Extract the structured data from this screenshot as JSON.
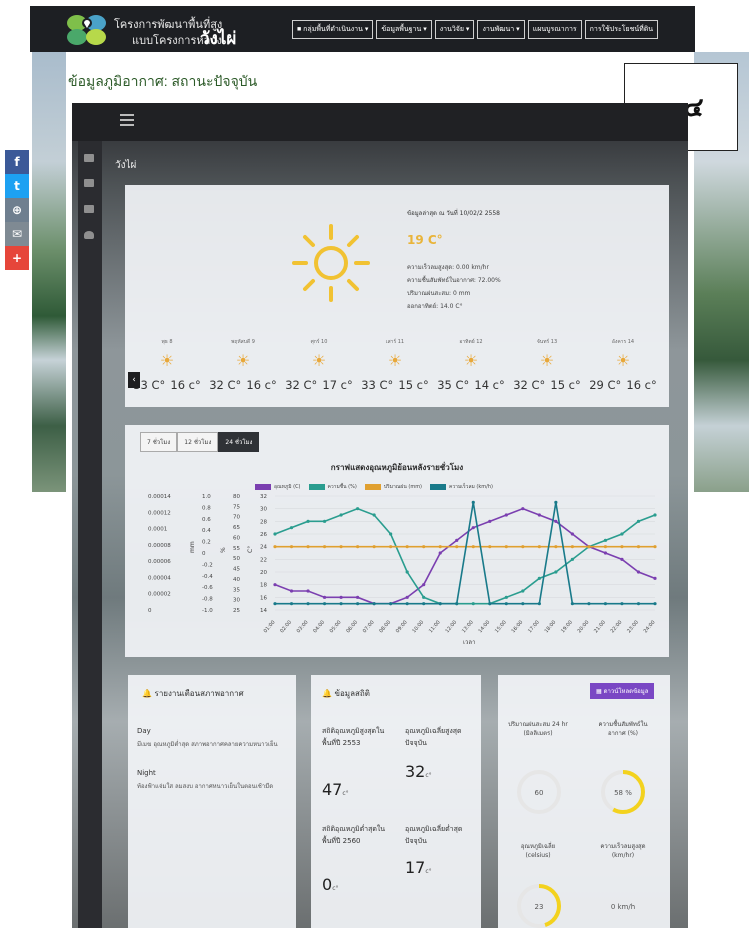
{
  "header": {
    "logo_line1": "โครงการพัฒนาพื้นที่สูง",
    "logo_line2": "แบบโครงการหลวง",
    "site_name": "วังไผ่",
    "nav": [
      {
        "label": "■ กลุ่มพื้นที่ดำเนินงาน ▾"
      },
      {
        "label": "ข้อมูลพื้นฐาน ▾"
      },
      {
        "label": "งานวิจัย ▾"
      },
      {
        "label": "งานพัฒนา ▾"
      },
      {
        "label": "แผนบูรณาการ"
      },
      {
        "label": "การใช้ประโยชน์ที่ดิน"
      }
    ]
  },
  "share": {
    "facebook": "f",
    "twitter": "t",
    "link": "⊕",
    "email": "✉",
    "more": "+"
  },
  "page_title": "ข้อมูลภูมิอากาศ: สถานะปัจจุบัน",
  "badge": "๑.๔",
  "location": "วังไผ่",
  "current": {
    "updated": "ข้อมูลล่าสุด ณ วันที่ 10/02/2 2558",
    "temperature": "19 C°",
    "lines": [
      "ความเร็วลมสูงสุด: 0.00 km/hr",
      "ความชื้นสัมพัทธ์ในอากาศ: 72.00%",
      "ปริมาณฝนสะสม: 0 mm",
      "ออกอาทิตย์: 14.0 C°"
    ]
  },
  "forecast": [
    {
      "day": "พุธ 8",
      "high": "33 C°",
      "low": "16 c°"
    },
    {
      "day": "พฤหัสบดี 9",
      "high": "32 C°",
      "low": "16 c°"
    },
    {
      "day": "ศุกร์ 10",
      "high": "32 C°",
      "low": "17 c°"
    },
    {
      "day": "เสาร์ 11",
      "high": "33 C°",
      "low": "15 c°"
    },
    {
      "day": "อาทิตย์ 12",
      "high": "35 C°",
      "low": "14 c°"
    },
    {
      "day": "จันทร์ 13",
      "high": "32 C°",
      "low": "15 c°"
    },
    {
      "day": "อังคาร 14",
      "high": "29 C°",
      "low": "16 c°"
    }
  ],
  "chart_tabs": [
    "7 ชั่วโมง",
    "12 ชั่วโมง",
    "24 ชั่วโมง"
  ],
  "chart_data": {
    "type": "line",
    "title": "กราฟแสดงอุณหภูมิย้อนหลังรายชั่วโมง",
    "xlabel": "เวลา",
    "x": [
      "01:00",
      "02:00",
      "03:00",
      "04:00",
      "05:00",
      "06:00",
      "07:00",
      "08:00",
      "09:00",
      "10:00",
      "11:00",
      "12:00",
      "13:00",
      "14:00",
      "15:00",
      "16:00",
      "17:00",
      "18:00",
      "19:00",
      "20:00",
      "21:00",
      "22:00",
      "23:00",
      "24:00"
    ],
    "axes": [
      {
        "ticks": [
          "0.00014",
          "0.00012",
          "0.0001",
          "0.00008",
          "0.00006",
          "0.00004",
          "0.00002",
          "0"
        ]
      },
      {
        "label": "mm",
        "ticks": [
          "1.0",
          "0.8",
          "0.6",
          "0.4",
          "0.2",
          "0",
          "-0.2",
          "-0.4",
          "-0.6",
          "-0.8",
          "-1.0"
        ]
      },
      {
        "label": "%",
        "ticks": [
          "80",
          "75",
          "70",
          "65",
          "60",
          "55",
          "50",
          "45",
          "40",
          "35",
          "30",
          "25"
        ]
      },
      {
        "label": "C°",
        "ticks": [
          "32",
          "30",
          "28",
          "26",
          "24",
          "22",
          "20",
          "18",
          "16",
          "14"
        ]
      }
    ],
    "series": [
      {
        "name": "อุณหภูมิ (C)",
        "color": "#7b3fb0",
        "values": [
          18,
          17,
          17,
          16,
          16,
          16,
          15,
          15,
          16,
          18,
          23,
          25,
          27,
          28,
          29,
          30,
          29,
          28,
          26,
          24,
          23,
          22,
          20,
          19
        ]
      },
      {
        "name": "ความชื้น (%)",
        "color": "#2a9d8f",
        "values": [
          26,
          27,
          28,
          28,
          29,
          30,
          29,
          26,
          20,
          16,
          15,
          15,
          15,
          15,
          16,
          17,
          19,
          20,
          22,
          24,
          25,
          26,
          28,
          29
        ]
      },
      {
        "name": "ปริมาณฝน (mm)",
        "color": "#e0a030",
        "values": [
          24,
          24,
          24,
          24,
          24,
          24,
          24,
          24,
          24,
          24,
          24,
          24,
          24,
          24,
          24,
          24,
          24,
          24,
          24,
          24,
          24,
          24,
          24,
          24
        ]
      },
      {
        "name": "ความเร็วลม (km/h)",
        "color": "#197a8a",
        "values": [
          15,
          15,
          15,
          15,
          15,
          15,
          15,
          15,
          15,
          15,
          15,
          15,
          31,
          15,
          15,
          15,
          15,
          31,
          15,
          15,
          15,
          15,
          15,
          15
        ]
      }
    ]
  },
  "alerts": {
    "title": "รายงานเตือนสภาพอากาศ",
    "day_label": "Day",
    "day_text": "มีเมฆ อุณหภูมิต่ำสุด สภาพอากาศคลายความหนาวเย็น",
    "night_label": "Night",
    "night_text": "ท้องฟ้าแจ่มใส ลมสงบ อากาศหนาวเย็นในตอนเช้ามืด"
  },
  "stats": {
    "title": "ข้อมูลสถิติ",
    "max_record_label": "สถิติอุณหภูมิสูงสุดในพื้นที่ปี 2553",
    "max_record_value": "47",
    "max_current_label": "อุณหภูมิเฉลี่ยสูงสุดปัจจุบัน",
    "max_current_value": "32",
    "min_record_label": "สถิติอุณหภูมิต่ำสุดในพื้นที่ปี 2560",
    "min_record_value": "0",
    "min_current_label": "อุณหภูมิเฉลี่ยต่ำสุดปัจจุบัน",
    "min_current_value": "17",
    "unit": "c°"
  },
  "gauges": {
    "all_button": "▦ ดาวน์โหลดข้อมูล",
    "rain_label": "ปริมาณฝนสะสม 24 hr (มิลลิเมตร)",
    "rain_value": "60",
    "humidity_label": "ความชื้นสัมพัทธ์ในอากาศ (%)",
    "humidity_value": "58 %",
    "humidity_level": 0.58,
    "temp_label": "อุณหภูมิเฉลี่ย (celsius)",
    "temp_value": "23",
    "temp_level": 0.45,
    "wind_label": "ความเร็วลมสูงสุด (km/hr)",
    "wind_value": "0 km/h"
  }
}
